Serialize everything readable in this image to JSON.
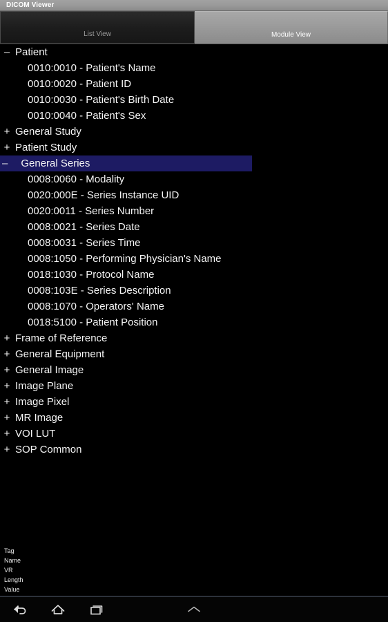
{
  "window": {
    "title": "DICOM Viewer"
  },
  "tabs": [
    {
      "label": "List View",
      "selected": true,
      "name": "tab-list-view"
    },
    {
      "label": "Module View",
      "selected": false,
      "name": "tab-module-view"
    }
  ],
  "tree": {
    "expand_marker": "+",
    "collapse_marker": "–",
    "selection_color": "#1d1b63",
    "nodes": [
      {
        "label": "Patient",
        "expanded": true,
        "selected": false,
        "children": [
          "0010:0010 - Patient's Name",
          "0010:0020 - Patient ID",
          "0010:0030 - Patient's Birth Date",
          "0010:0040 - Patient's Sex"
        ]
      },
      {
        "label": "General Study",
        "expanded": false,
        "selected": false,
        "children": []
      },
      {
        "label": "Patient Study",
        "expanded": false,
        "selected": false,
        "children": []
      },
      {
        "label": "General Series",
        "expanded": true,
        "selected": true,
        "children": [
          "0008:0060 - Modality",
          "0020:000E - Series Instance UID",
          "0020:0011 - Series Number",
          "0008:0021 - Series Date",
          "0008:0031 - Series Time",
          "0008:1050 - Performing Physician's Name",
          "0018:1030 - Protocol Name",
          "0008:103E - Series Description",
          "0008:1070 - Operators' Name",
          "0018:5100 - Patient Position"
        ]
      },
      {
        "label": "Frame of Reference",
        "expanded": false,
        "selected": false,
        "children": []
      },
      {
        "label": "General Equipment",
        "expanded": false,
        "selected": false,
        "children": []
      },
      {
        "label": "General Image",
        "expanded": false,
        "selected": false,
        "children": []
      },
      {
        "label": "Image Plane",
        "expanded": false,
        "selected": false,
        "children": []
      },
      {
        "label": "Image Pixel",
        "expanded": false,
        "selected": false,
        "children": []
      },
      {
        "label": "MR Image",
        "expanded": false,
        "selected": false,
        "children": []
      },
      {
        "label": "VOI LUT",
        "expanded": false,
        "selected": false,
        "children": []
      },
      {
        "label": "SOP Common",
        "expanded": false,
        "selected": false,
        "children": []
      }
    ]
  },
  "detail": {
    "fields": [
      {
        "label": "Tag",
        "value": ""
      },
      {
        "label": "Name",
        "value": ""
      },
      {
        "label": "VR",
        "value": ""
      },
      {
        "label": "Length",
        "value": ""
      },
      {
        "label": "Value",
        "value": ""
      }
    ]
  },
  "navbar": {
    "buttons": [
      {
        "name": "back-icon",
        "label": "Back"
      },
      {
        "name": "home-icon",
        "label": "Home"
      },
      {
        "name": "recents-icon",
        "label": "Recent apps"
      },
      {
        "name": "chevron-up-icon",
        "label": "Show navigation"
      }
    ]
  }
}
